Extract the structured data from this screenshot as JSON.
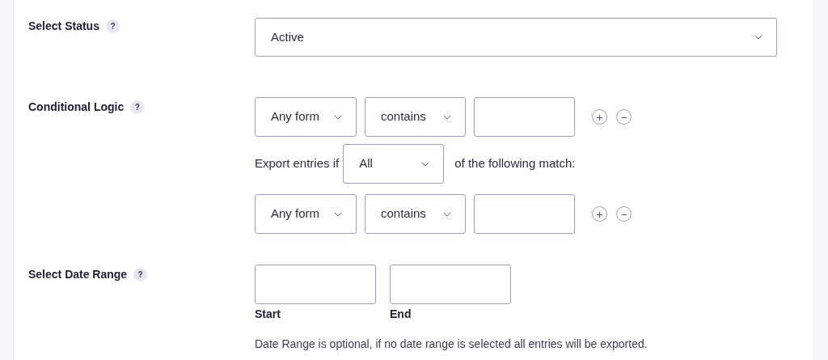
{
  "status": {
    "label": "Select Status",
    "help": "?",
    "value": "Active"
  },
  "conditional_logic": {
    "label": "Conditional Logic",
    "help": "?",
    "rules": [
      {
        "field": "Any form",
        "operator": "contains",
        "add": "+",
        "remove": "−"
      },
      {
        "field": "Any form",
        "operator": "contains",
        "add": "+",
        "remove": "−"
      }
    ],
    "match_prefix": "Export entries if",
    "match_value": "All",
    "match_suffix": "of the following match:"
  },
  "date_range": {
    "label": "Select Date Range",
    "help": "?",
    "start_label": "Start",
    "end_label": "End",
    "note": "Date Range is optional, if no date range is selected all entries will be exported."
  }
}
